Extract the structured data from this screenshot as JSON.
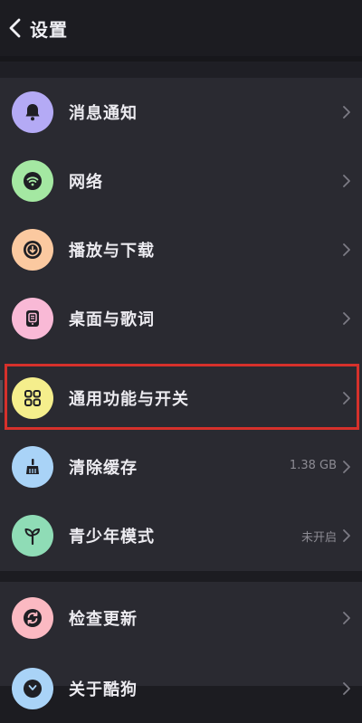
{
  "header": {
    "title": "设置"
  },
  "colors": {
    "background": "#1c1c21",
    "card": "#2a2a31",
    "highlight_border": "#d6312b"
  },
  "items": [
    {
      "label": "消息通知",
      "icon": "bell-icon",
      "icon_bg": "#b4aaf5",
      "value": ""
    },
    {
      "label": "网络",
      "icon": "wifi-icon",
      "icon_bg": "#a4e8a2",
      "value": ""
    },
    {
      "label": "播放与下载",
      "icon": "download-icon",
      "icon_bg": "#fbc9a0",
      "value": ""
    },
    {
      "label": "桌面与歌词",
      "icon": "lyrics-widget-icon",
      "icon_bg": "#f9b9d6",
      "value": ""
    },
    {
      "label": "通用功能与开关",
      "icon": "grid-apps-icon",
      "icon_bg": "#f5ee8c",
      "value": ""
    },
    {
      "label": "清除缓存",
      "icon": "broom-icon",
      "icon_bg": "#a9d3f7",
      "value": "1.38 GB"
    },
    {
      "label": "青少年模式",
      "icon": "sprout-icon",
      "icon_bg": "#8fdcb6",
      "value": "未开启"
    }
  ],
  "items_group2": [
    {
      "label": "检查更新",
      "icon": "refresh-icon",
      "icon_bg": "#fbb9c2",
      "value": ""
    },
    {
      "label": "关于酷狗",
      "icon": "info-icon",
      "icon_bg": "#a9d3f7",
      "value": ""
    }
  ],
  "highlighted_item": "通用功能与开关"
}
